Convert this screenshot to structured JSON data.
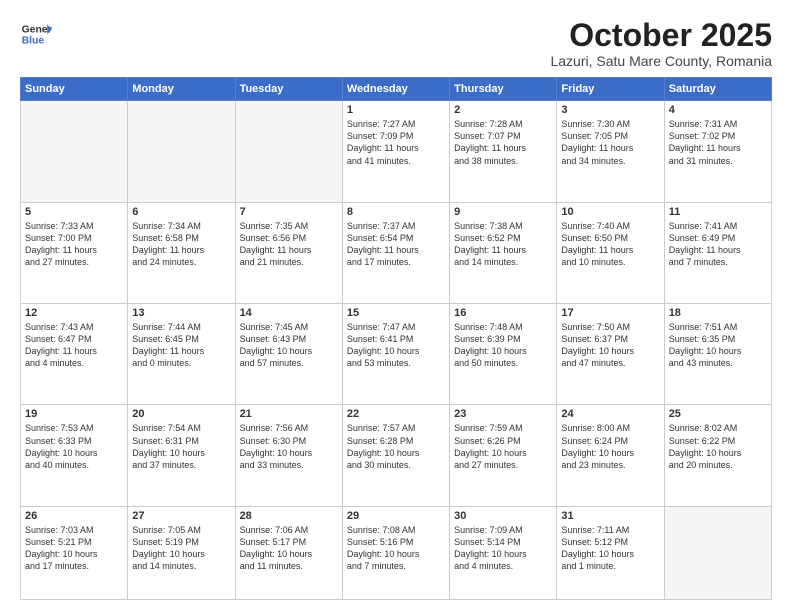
{
  "header": {
    "logo_line1": "General",
    "logo_line2": "Blue",
    "month": "October 2025",
    "location": "Lazuri, Satu Mare County, Romania"
  },
  "days_of_week": [
    "Sunday",
    "Monday",
    "Tuesday",
    "Wednesday",
    "Thursday",
    "Friday",
    "Saturday"
  ],
  "weeks": [
    [
      {
        "day": "",
        "info": ""
      },
      {
        "day": "",
        "info": ""
      },
      {
        "day": "",
        "info": ""
      },
      {
        "day": "1",
        "info": "Sunrise: 7:27 AM\nSunset: 7:09 PM\nDaylight: 11 hours\nand 41 minutes."
      },
      {
        "day": "2",
        "info": "Sunrise: 7:28 AM\nSunset: 7:07 PM\nDaylight: 11 hours\nand 38 minutes."
      },
      {
        "day": "3",
        "info": "Sunrise: 7:30 AM\nSunset: 7:05 PM\nDaylight: 11 hours\nand 34 minutes."
      },
      {
        "day": "4",
        "info": "Sunrise: 7:31 AM\nSunset: 7:02 PM\nDaylight: 11 hours\nand 31 minutes."
      }
    ],
    [
      {
        "day": "5",
        "info": "Sunrise: 7:33 AM\nSunset: 7:00 PM\nDaylight: 11 hours\nand 27 minutes."
      },
      {
        "day": "6",
        "info": "Sunrise: 7:34 AM\nSunset: 6:58 PM\nDaylight: 11 hours\nand 24 minutes."
      },
      {
        "day": "7",
        "info": "Sunrise: 7:35 AM\nSunset: 6:56 PM\nDaylight: 11 hours\nand 21 minutes."
      },
      {
        "day": "8",
        "info": "Sunrise: 7:37 AM\nSunset: 6:54 PM\nDaylight: 11 hours\nand 17 minutes."
      },
      {
        "day": "9",
        "info": "Sunrise: 7:38 AM\nSunset: 6:52 PM\nDaylight: 11 hours\nand 14 minutes."
      },
      {
        "day": "10",
        "info": "Sunrise: 7:40 AM\nSunset: 6:50 PM\nDaylight: 11 hours\nand 10 minutes."
      },
      {
        "day": "11",
        "info": "Sunrise: 7:41 AM\nSunset: 6:49 PM\nDaylight: 11 hours\nand 7 minutes."
      }
    ],
    [
      {
        "day": "12",
        "info": "Sunrise: 7:43 AM\nSunset: 6:47 PM\nDaylight: 11 hours\nand 4 minutes."
      },
      {
        "day": "13",
        "info": "Sunrise: 7:44 AM\nSunset: 6:45 PM\nDaylight: 11 hours\nand 0 minutes."
      },
      {
        "day": "14",
        "info": "Sunrise: 7:45 AM\nSunset: 6:43 PM\nDaylight: 10 hours\nand 57 minutes."
      },
      {
        "day": "15",
        "info": "Sunrise: 7:47 AM\nSunset: 6:41 PM\nDaylight: 10 hours\nand 53 minutes."
      },
      {
        "day": "16",
        "info": "Sunrise: 7:48 AM\nSunset: 6:39 PM\nDaylight: 10 hours\nand 50 minutes."
      },
      {
        "day": "17",
        "info": "Sunrise: 7:50 AM\nSunset: 6:37 PM\nDaylight: 10 hours\nand 47 minutes."
      },
      {
        "day": "18",
        "info": "Sunrise: 7:51 AM\nSunset: 6:35 PM\nDaylight: 10 hours\nand 43 minutes."
      }
    ],
    [
      {
        "day": "19",
        "info": "Sunrise: 7:53 AM\nSunset: 6:33 PM\nDaylight: 10 hours\nand 40 minutes."
      },
      {
        "day": "20",
        "info": "Sunrise: 7:54 AM\nSunset: 6:31 PM\nDaylight: 10 hours\nand 37 minutes."
      },
      {
        "day": "21",
        "info": "Sunrise: 7:56 AM\nSunset: 6:30 PM\nDaylight: 10 hours\nand 33 minutes."
      },
      {
        "day": "22",
        "info": "Sunrise: 7:57 AM\nSunset: 6:28 PM\nDaylight: 10 hours\nand 30 minutes."
      },
      {
        "day": "23",
        "info": "Sunrise: 7:59 AM\nSunset: 6:26 PM\nDaylight: 10 hours\nand 27 minutes."
      },
      {
        "day": "24",
        "info": "Sunrise: 8:00 AM\nSunset: 6:24 PM\nDaylight: 10 hours\nand 23 minutes."
      },
      {
        "day": "25",
        "info": "Sunrise: 8:02 AM\nSunset: 6:22 PM\nDaylight: 10 hours\nand 20 minutes."
      }
    ],
    [
      {
        "day": "26",
        "info": "Sunrise: 7:03 AM\nSunset: 5:21 PM\nDaylight: 10 hours\nand 17 minutes."
      },
      {
        "day": "27",
        "info": "Sunrise: 7:05 AM\nSunset: 5:19 PM\nDaylight: 10 hours\nand 14 minutes."
      },
      {
        "day": "28",
        "info": "Sunrise: 7:06 AM\nSunset: 5:17 PM\nDaylight: 10 hours\nand 11 minutes."
      },
      {
        "day": "29",
        "info": "Sunrise: 7:08 AM\nSunset: 5:16 PM\nDaylight: 10 hours\nand 7 minutes."
      },
      {
        "day": "30",
        "info": "Sunrise: 7:09 AM\nSunset: 5:14 PM\nDaylight: 10 hours\nand 4 minutes."
      },
      {
        "day": "31",
        "info": "Sunrise: 7:11 AM\nSunset: 5:12 PM\nDaylight: 10 hours\nand 1 minute."
      },
      {
        "day": "",
        "info": ""
      }
    ]
  ]
}
